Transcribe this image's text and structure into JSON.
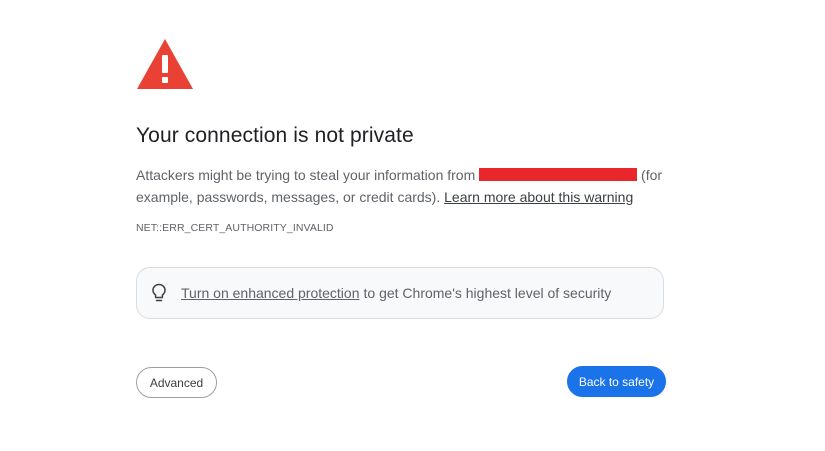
{
  "interstitial": {
    "title": "Your connection is not private",
    "message_before": "Attackers might be trying to steal your information from ",
    "message_after": " (for example, passwords, messages, or credit cards). ",
    "learn_more_link": "Learn more about this warning",
    "error_code": "NET::ERR_CERT_AUTHORITY_INVALID",
    "redaction_color": "#e8262c",
    "warning_icon": "warning-triangle-icon",
    "warning_color": "#e94235"
  },
  "protection": {
    "icon": "lightbulb-icon",
    "link_text": "Turn on enhanced protection",
    "trailing_text": " to get Chrome's highest level of security"
  },
  "buttons": {
    "advanced_label": "Advanced",
    "back_to_safety_label": "Back to safety",
    "primary_color": "#1a73e8"
  }
}
